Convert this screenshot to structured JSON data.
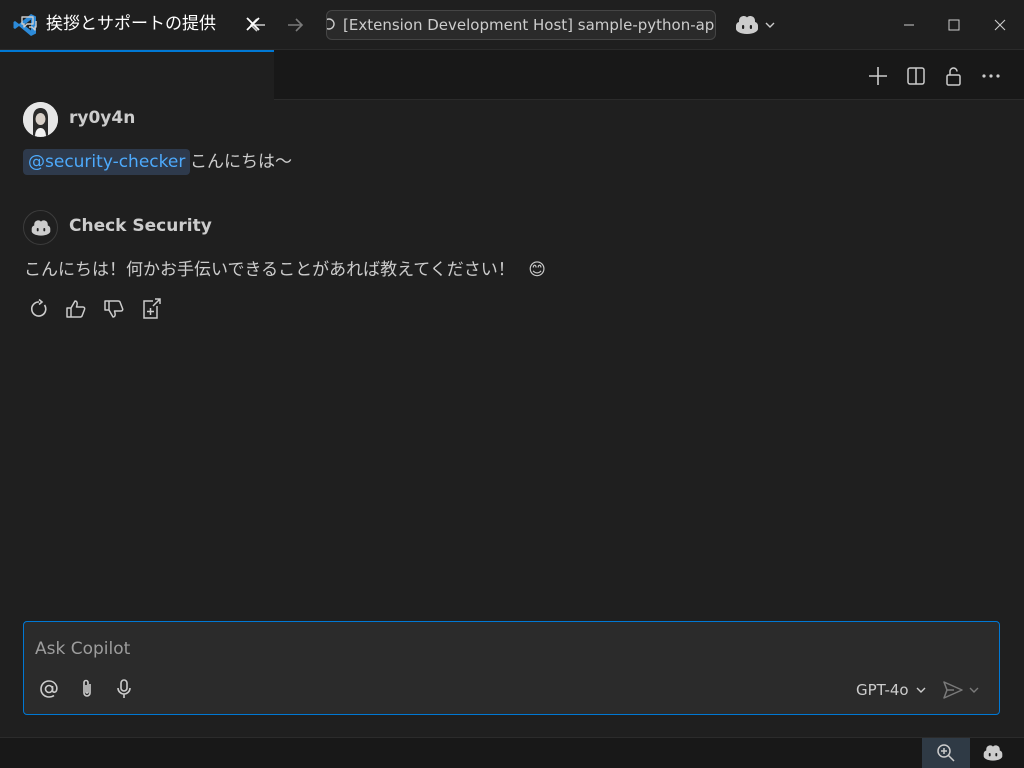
{
  "colors": {
    "accent": "#0078d4",
    "mention": "#4daafc",
    "background": "#1f1f1f"
  },
  "titlebar": {
    "command_center_text": "[Extension Development Host] sample-python-ap"
  },
  "tab": {
    "label": "挨拶とサポートの提供"
  },
  "chat": {
    "user": {
      "name": "ry0y4n",
      "mention": "@security-checker",
      "message": "こんにちは〜"
    },
    "assistant": {
      "name": "Check Security",
      "message": "こんにちは！何かお手伝いできることがあれば教えてください！",
      "emoji": "😊"
    }
  },
  "input": {
    "placeholder": "Ask Copilot",
    "model": "GPT-4o"
  },
  "icons": {
    "message_actions": [
      "retry-icon",
      "thumbs-up-icon",
      "thumbs-down-icon",
      "insert-into-editor-icon"
    ],
    "input_actions": [
      "mention-icon",
      "attach-icon",
      "microphone-icon"
    ]
  }
}
